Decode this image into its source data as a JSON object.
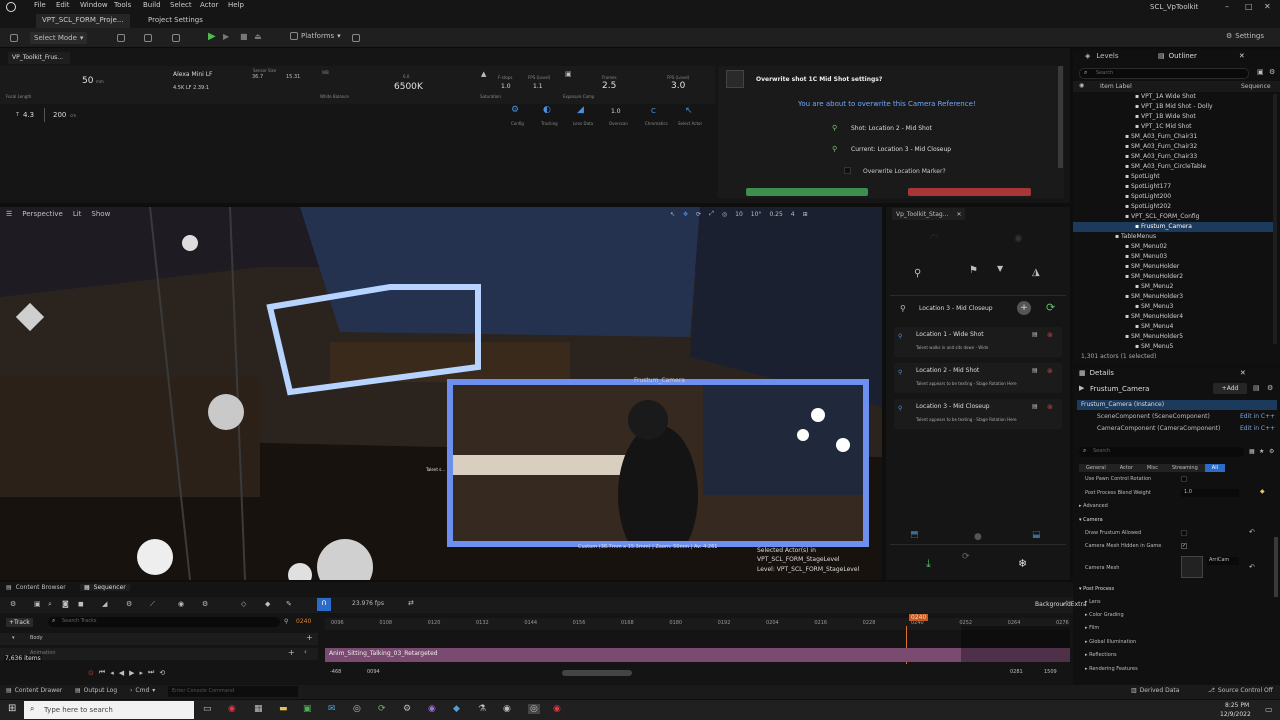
{
  "titlebar": {
    "menus": [
      "File",
      "Edit",
      "Window",
      "Tools",
      "Build",
      "Select",
      "Actor",
      "Help"
    ],
    "tabs": [
      "VPT_SCL_FORM_Proje...",
      "Project Settings"
    ],
    "project": "SCL_VpToolkit"
  },
  "toolbar": {
    "select_mode": "Select Mode",
    "platforms": "Platforms",
    "settings": "Settings"
  },
  "vptoolkit": {
    "tab": "VP_Toolkit_Frus...",
    "focal_value": "50",
    "focal_unit": "mm",
    "focal_label": "Focal Length",
    "camera": "Alexa Mini LF",
    "format": "4.5K LF 2.39:1",
    "sensor_label": "Sensor Size",
    "sensor_w": "36.7",
    "sensor_h": "15.31",
    "wb_label": "WB",
    "wb_value": "6500",
    "wb_unit": "K",
    "wb_small": "6.0",
    "wb_balance": "White Balance",
    "saturation_label": "Saturation",
    "fstops_label": "F-stops",
    "fstops": "1.0",
    "fps_level_label": "FPS (Level)",
    "fps_level": "1.1",
    "exposure_label": "Exposure Comp",
    "frames_label": "Frames",
    "frames": "2.5",
    "fps_label2": "FPS (Level)",
    "fps2": "3.0",
    "aperture": "4.3",
    "focus": "200",
    "focus_unit": "cm",
    "icons": [
      "Config",
      "Tracking",
      "Lens Data",
      "Overscan",
      "Chromatics",
      "Select Actor"
    ],
    "overscan": "1.0",
    "chroma": "C"
  },
  "dialog": {
    "title": "Overwrite shot 1C Mid Shot settings?",
    "message": "You are about to overwrite this Camera Reference!",
    "shot": "Shot: Location 2 - Mid Shot",
    "current": "Current: Location 3 - Mid Closeup",
    "marker": "Overwrite Location Marker?"
  },
  "viewport": {
    "perspective": "Perspective",
    "lit": "Lit",
    "show": "Show",
    "grid": "10",
    "angle": "10°",
    "scale": "0.25",
    "cams": "4",
    "pip_label": "Frustum_Camera",
    "pip_info": "Custom (36.7mm x 15.3mm) | Zoom: 50mm | Av: 4.261",
    "talent_tag": "Talent s...",
    "selected": "Selected Actor(s) in",
    "level_name": "VPT_SCL_FORM_StageLevel",
    "level_label": "Level: VPT_SCL_FORM_StageLevel"
  },
  "stagepanel": {
    "tab": "Vp_Toolkit_Stag...",
    "current": "Location 3 - Mid Closeup",
    "locations": [
      {
        "title": "Location 1 - Wide Shot",
        "desc": "Talent walks in and sits down - Wide"
      },
      {
        "title": "Location 2 - Mid Shot",
        "desc": "Talent appears to be texting - Stage Rotation Here"
      },
      {
        "title": "Location 3 - Mid Closeup",
        "desc": "Talent appears to be texting - Stage Rotation Here"
      }
    ]
  },
  "outliner": {
    "tabs": [
      "Levels",
      "Outliner"
    ],
    "search": "Search",
    "col_label": "Item Label",
    "col_seq": "Sequence",
    "items": [
      {
        "label": "VPT_1A Wide Shot",
        "indent": 2
      },
      {
        "label": "VPT_1B Mid Shot - Dolly",
        "indent": 2
      },
      {
        "label": "VPT_1B Wide Shot",
        "indent": 2
      },
      {
        "label": "VPT_1C Mid Shot",
        "indent": 2
      },
      {
        "label": "SM_A03_Furn_Chair31",
        "indent": 1
      },
      {
        "label": "SM_A03_Furn_Chair32",
        "indent": 1
      },
      {
        "label": "SM_A03_Furn_Chair33",
        "indent": 1
      },
      {
        "label": "SM_A03_Furn_CircleTable",
        "indent": 1
      },
      {
        "label": "SpotLight",
        "indent": 1
      },
      {
        "label": "SpotLight177",
        "indent": 1
      },
      {
        "label": "SpotLight200",
        "indent": 1
      },
      {
        "label": "SpotLight202",
        "indent": 1
      },
      {
        "label": "VPT_SCL_FORM_Config",
        "indent": 1
      },
      {
        "label": "Frustum_Camera",
        "indent": 2,
        "selected": true
      },
      {
        "label": "TableMenus",
        "indent": 0
      },
      {
        "label": "SM_Menu02",
        "indent": 1
      },
      {
        "label": "SM_Menu03",
        "indent": 1
      },
      {
        "label": "SM_MenuHolder",
        "indent": 1
      },
      {
        "label": "SM_MenuHolder2",
        "indent": 1
      },
      {
        "label": "SM_Menu2",
        "indent": 2
      },
      {
        "label": "SM_MenuHolder3",
        "indent": 1
      },
      {
        "label": "SM_Menu3",
        "indent": 2
      },
      {
        "label": "SM_MenuHolder4",
        "indent": 1
      },
      {
        "label": "SM_Menu4",
        "indent": 2
      },
      {
        "label": "SM_MenuHolder5",
        "indent": 1
      },
      {
        "label": "SM_Menu5",
        "indent": 2
      }
    ],
    "count": "1,301 actors (1 selected)"
  },
  "details": {
    "tab": "Details",
    "actor": "Frustum_Camera",
    "add": "+Add",
    "instance": "Frustum_Camera (Instance)",
    "components": [
      {
        "name": "SceneComponent (SceneComponent)",
        "link": "Edit in C++"
      },
      {
        "name": "CameraComponent (CameraComponent)",
        "link": "Edit in C++"
      }
    ],
    "search": "Search",
    "filters": [
      "General",
      "Actor",
      "Misc",
      "Streaming",
      "All"
    ],
    "pawn": "Use Pawn Control Rotation",
    "blend": "Post Process Blend Weight",
    "blend_val": "1.0",
    "advanced": "Advanced",
    "camera": "Camera",
    "draw_frustum": "Draw Frustum Allowed",
    "mesh_hidden": "Camera Mesh Hidden in Game",
    "mesh": "Camera Mesh",
    "mesh_asset": "ArriCam",
    "post": "Post Process",
    "post_items": [
      "Lens",
      "Color Grading",
      "Film",
      "Global Illumination",
      "Reflections",
      "Rendering Features"
    ]
  },
  "bottom": {
    "tabs": [
      "Content Browser",
      "Sequencer"
    ],
    "fps": "23.976 fps",
    "track": "+Track",
    "search": "Search Tracks",
    "frame": "0240",
    "body": "Body",
    "animation": "Animation",
    "items": "7,636 items",
    "clip": "Anim_Sitting_Talking_03_Retargeted",
    "ticks": [
      "0096",
      "0108",
      "0120",
      "0132",
      "0144",
      "0156",
      "0168",
      "0180",
      "0192",
      "0204",
      "0216",
      "0228",
      "0240",
      "0252",
      "0264",
      "0276"
    ],
    "start": "-468",
    "start2": "0094",
    "end": "0281",
    "end2": "1509",
    "extra": "BackgroundExtra"
  },
  "statusbar": {
    "drawer": "Content Drawer",
    "output": "Output Log",
    "cmd": "Cmd",
    "console": "Enter Console Command",
    "derived": "Derived Data",
    "source": "Source Control Off"
  },
  "taskbar": {
    "search": "Type here to search",
    "time": "8:25 PM",
    "date": "12/9/2022"
  }
}
